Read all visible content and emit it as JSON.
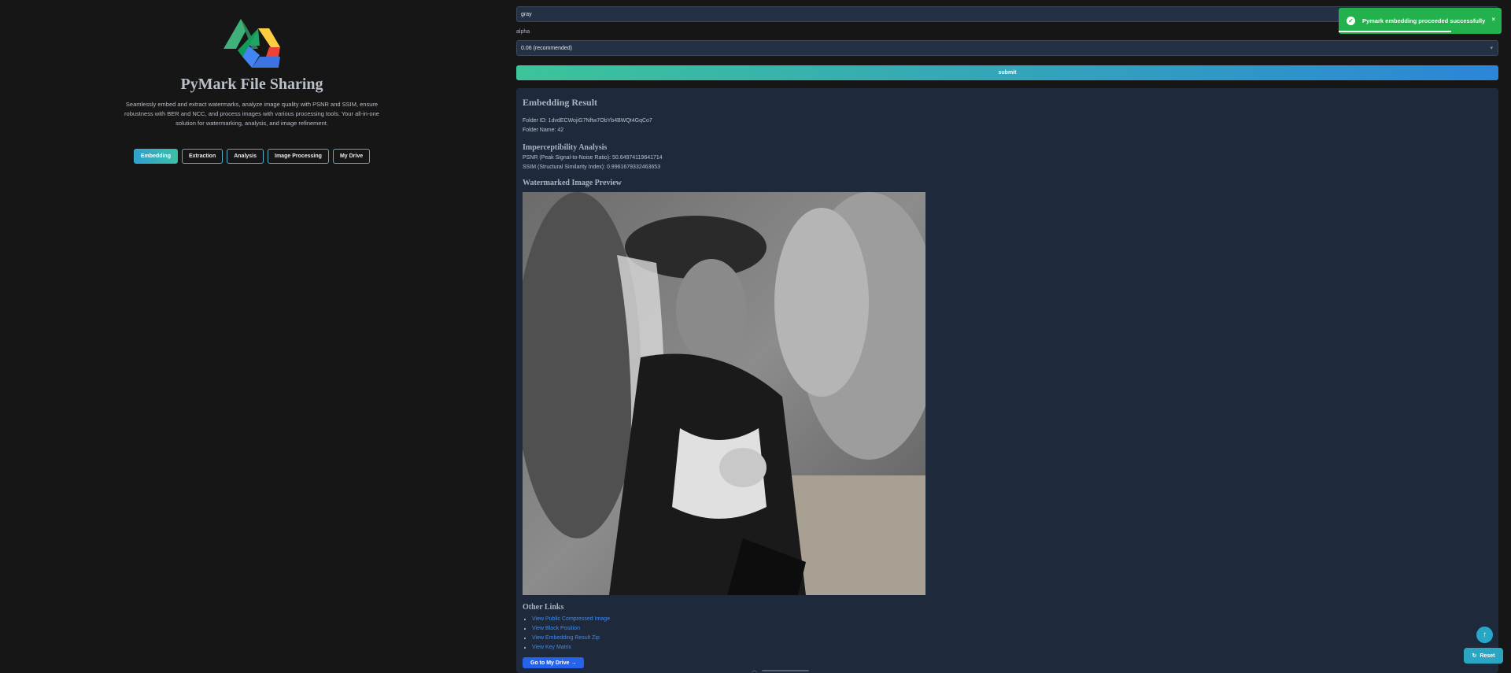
{
  "app": {
    "title": "PyMark File Sharing",
    "description": "Seamlessly embed and extract watermarks, analyze image quality with PSNR and SSIM, ensure robustness with BER and NCC, and process images with various processing tools. Your all-in-one solution for watermarking, analysis, and image refinement."
  },
  "nav": {
    "tabs": [
      {
        "label": "Embedding",
        "active": true
      },
      {
        "label": "Extraction",
        "active": false
      },
      {
        "label": "Analysis",
        "active": false
      },
      {
        "label": "Image Processing",
        "active": false
      },
      {
        "label": "My Drive",
        "active": false
      }
    ]
  },
  "form": {
    "type_value": "gray",
    "alpha_label": "alpha",
    "alpha_value": "0.06 (recommended)",
    "submit_label": "submit"
  },
  "result": {
    "title": "Embedding Result",
    "folder_id": "Folder ID: 1dvdECWojiG7Nftw7ObYb4BWQt4GqCo7",
    "folder_name": "Folder Name: 42",
    "imperceptibility_title": "Imperceptibility Analysis",
    "psnr": "PSNR (Peak Signal-to-Noise Ratio): 50.64974119641714",
    "ssim": "SSIM (Structural Similarity Index): 0.9961679332463653",
    "preview_title": "Watermarked Image Preview",
    "other_links_title": "Other Links",
    "links": [
      "View Public Compressed Image",
      "View Block Position",
      "View Embedding Result Zip",
      "View Key Matrix"
    ],
    "drive_button": "Go to My Drive →"
  },
  "toast": {
    "message": "Pymark embedding proceeded successfully",
    "progress": 0.69,
    "color": "#22b14c"
  },
  "floating": {
    "reset_label": "Reset",
    "scroll_top_icon": "arrow-up-icon"
  },
  "colors": {
    "accent_gradient_start": "#3cc49a",
    "accent_gradient_end": "#2b86d8",
    "link": "#3d8bf0",
    "card_bg": "#1e2a3b"
  }
}
